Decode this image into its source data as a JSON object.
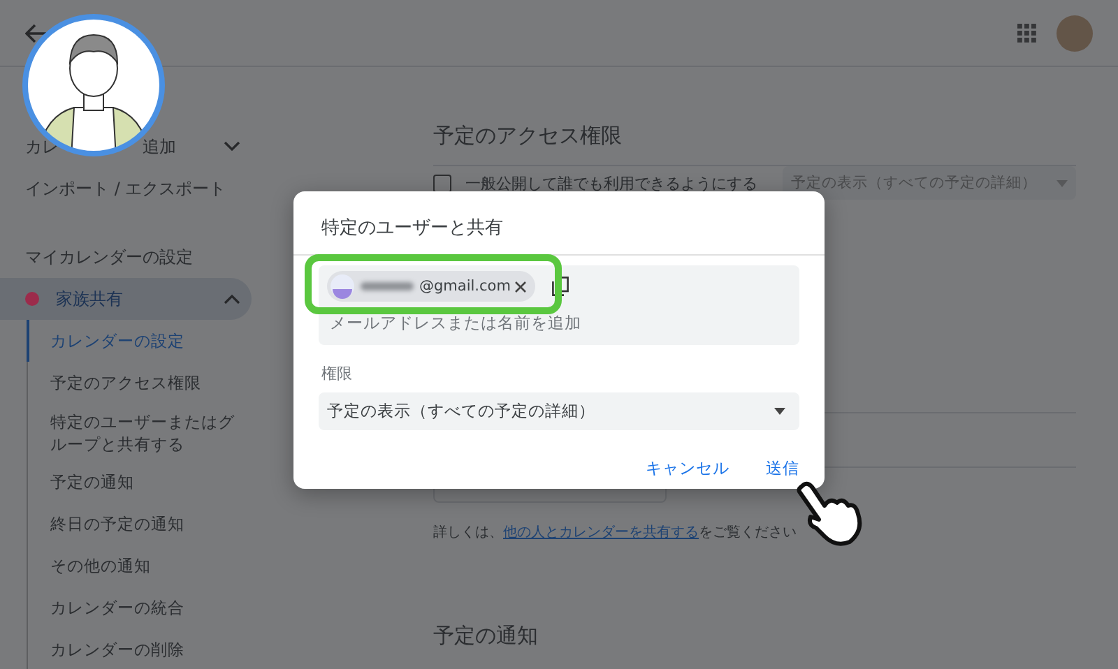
{
  "sidebar": {
    "add_calendar": {
      "label_parts": [
        "カレ",
        "追加"
      ],
      "expanded": false
    },
    "import_export": "インポート / エクスポート",
    "section_title": "マイカレンダーの設定",
    "calendar": {
      "name": "家族共有",
      "color": "#9c2b4b",
      "expanded": true,
      "selected": true
    },
    "sub_items": [
      {
        "label": "カレンダーの設定",
        "selected": true
      },
      {
        "label": "予定のアクセス権限",
        "selected": false
      },
      {
        "label": "特定のユーザーまたはグループと共有する",
        "selected": false
      },
      {
        "label": "予定の通知",
        "selected": false
      },
      {
        "label": "終日の予定の通知",
        "selected": false
      },
      {
        "label": "その他の通知",
        "selected": false
      },
      {
        "label": "カレンダーの統合",
        "selected": false
      },
      {
        "label": "カレンダーの削除",
        "selected": false
      }
    ]
  },
  "main": {
    "access_section": {
      "title": "予定のアクセス権限",
      "public_option": {
        "label": "一般公開して誰でも利用できるようにする",
        "checked": false
      },
      "visibility_select": {
        "value": "予定の表示（すべての予定の詳細）",
        "disabled": true
      }
    },
    "help_text": {
      "prefix": "詳しくは、",
      "link": "他の人とカレンダーを共有する",
      "suffix": "をご覧ください"
    },
    "next_section_title": "予定の通知"
  },
  "dialog": {
    "title": "特定のユーザーと共有",
    "recipients": [
      {
        "email": "@gmail.com"
      }
    ],
    "placeholder": "メールアドレスまたは名前を追加",
    "permission_label": "権限",
    "permission_value": "予定の表示（すべての予定の詳細）",
    "buttons": [
      {
        "label": "キャンセル"
      },
      {
        "label": "送信"
      }
    ]
  }
}
